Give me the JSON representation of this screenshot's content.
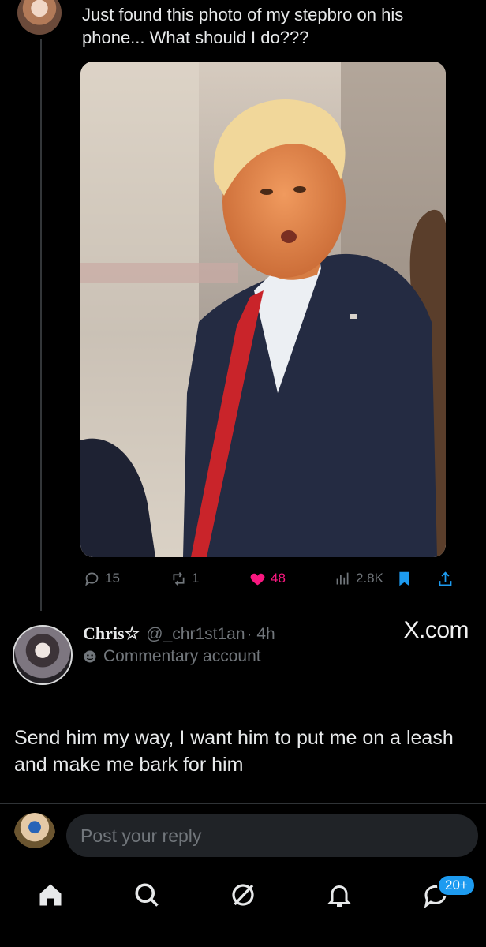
{
  "original_post": {
    "text": "Just found this photo of my stepbro on his phone... What should I do???",
    "stats": {
      "replies": "15",
      "reposts": "1",
      "likes": "48",
      "views": "2.8K"
    }
  },
  "reply_post": {
    "author_name": "Chris☆",
    "handle": "@_chr1st1an",
    "time": "· 4h",
    "account_label": "Commentary account",
    "text": "Send him my way, I want him to put me on a leash and make me bark for him",
    "source": "X.com"
  },
  "composer": {
    "placeholder": "Post your reply"
  },
  "tabbar": {
    "badge": "20+",
    "items": [
      "home-icon",
      "search-icon",
      "grok-icon",
      "bell-icon",
      "messages-icon"
    ]
  },
  "colors": {
    "background": "#000000",
    "text": "#e7e9ea",
    "muted": "#71767b",
    "like": "#f91880",
    "accent": "#1d9bf0"
  }
}
